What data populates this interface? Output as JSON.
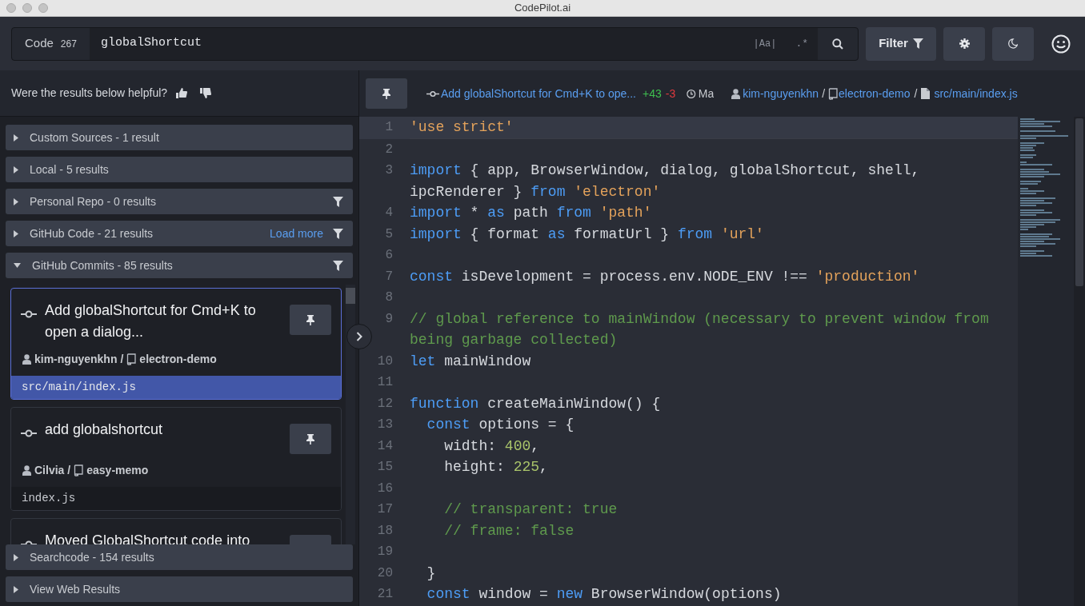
{
  "window": {
    "title": "CodePilot.ai"
  },
  "search": {
    "scope": "Code",
    "count": "267",
    "query": "globalShortcut",
    "case_toggle": "|Aa|",
    "regex_toggle": ".*"
  },
  "toolbar": {
    "filter_label": "Filter"
  },
  "feedback": {
    "question": "Were the results below helpful?"
  },
  "sections": [
    {
      "label": "Custom Sources - 1 result",
      "expanded": false,
      "filter": false
    },
    {
      "label": "Local - 5 results",
      "expanded": false,
      "filter": false
    },
    {
      "label": "Personal Repo - 0 results",
      "expanded": false,
      "filter": true
    },
    {
      "label": "GitHub Code - 21 results",
      "expanded": false,
      "filter": true,
      "action": "Load more"
    },
    {
      "label": "GitHub Commits - 85 results",
      "expanded": true,
      "filter": true,
      "results": [
        {
          "title": "Add globalShortcut for Cmd+K to open a dialog...",
          "author": "kim-nguyenkhn",
          "separator": "/",
          "repo": "electron-demo",
          "file": "src/main/index.js",
          "selected": true
        },
        {
          "title": "add globalshortcut",
          "author": "Cilvia",
          "separator": "/",
          "repo": "easy-memo",
          "file": "index.js",
          "selected": false
        },
        {
          "title": "Moved GlobalShortcut code into",
          "selected": false
        }
      ]
    },
    {
      "label": "Searchcode - 154 results",
      "expanded": false,
      "filter": false
    },
    {
      "label": "View Web Results",
      "expanded": false,
      "filter": false
    }
  ],
  "detail_bar": {
    "commit_title": "Add globalShortcut for Cmd+K to ope...",
    "additions": "+43",
    "deletions": "-3",
    "date": "Ma",
    "author": "kim-nguyenkhn",
    "separators": [
      "/",
      "/"
    ],
    "repo": "electron-demo",
    "path": "src/main/index.js"
  },
  "editor": {
    "lines": [
      {
        "n": "1",
        "current": true,
        "tokens": [
          {
            "kind": "string",
            "text": "'use strict'"
          }
        ]
      },
      {
        "n": "2",
        "current": false
      },
      {
        "n": "3",
        "current": false,
        "tokens": [
          {
            "kind": "keyword",
            "text": "import"
          },
          {
            "kind": "plain",
            "text": " { app, BrowserWindow, dialog, globalShortcut, shell, ipcRenderer } "
          },
          {
            "kind": "keyword",
            "text": "from "
          },
          {
            "kind": "string",
            "text": "'electron'"
          }
        ]
      },
      {
        "n": "4",
        "current": false,
        "tokens": [
          {
            "kind": "keyword",
            "text": "import"
          },
          {
            "kind": "plain",
            "text": " * "
          },
          {
            "kind": "keyword",
            "text": "as"
          },
          {
            "kind": "plain",
            "text": " path "
          },
          {
            "kind": "keyword",
            "text": "from "
          },
          {
            "kind": "string",
            "text": "'path'"
          }
        ]
      },
      {
        "n": "5",
        "current": false,
        "tokens": [
          {
            "kind": "keyword",
            "text": "import"
          },
          {
            "kind": "plain",
            "text": " { format "
          },
          {
            "kind": "keyword",
            "text": "as"
          },
          {
            "kind": "plain",
            "text": " formatUrl } "
          },
          {
            "kind": "keyword",
            "text": "from "
          },
          {
            "kind": "string",
            "text": "'url'"
          }
        ]
      },
      {
        "n": "6",
        "current": false
      },
      {
        "n": "7",
        "current": false,
        "tokens": [
          {
            "kind": "keyword",
            "text": "const"
          },
          {
            "kind": "plain",
            "text": " isDevelopment = process.env.NODE_ENV !== "
          },
          {
            "kind": "string",
            "text": "'production'"
          }
        ]
      },
      {
        "n": "8",
        "current": false
      },
      {
        "n": "9",
        "current": false,
        "tokens": [
          {
            "kind": "comment",
            "text": "// global reference to mainWindow (necessary to prevent window from being garbage collected)"
          }
        ]
      },
      {
        "n": "10",
        "current": false,
        "tokens": [
          {
            "kind": "keyword",
            "text": "let"
          },
          {
            "kind": "plain",
            "text": " mainWindow"
          }
        ]
      },
      {
        "n": "11",
        "current": false
      },
      {
        "n": "12",
        "current": false,
        "tokens": [
          {
            "kind": "keyword",
            "text": "function"
          },
          {
            "kind": "plain",
            "text": " createMainWindow() {"
          }
        ]
      },
      {
        "n": "13",
        "current": false,
        "tokens": [
          {
            "kind": "keyword",
            "text": "  const"
          },
          {
            "kind": "plain",
            "text": " options = {"
          }
        ]
      },
      {
        "n": "14",
        "current": false,
        "tokens": [
          {
            "kind": "plain",
            "text": "    width: "
          },
          {
            "kind": "number",
            "text": "400"
          },
          {
            "kind": "plain",
            "text": ","
          }
        ]
      },
      {
        "n": "15",
        "current": false,
        "tokens": [
          {
            "kind": "plain",
            "text": "    height: "
          },
          {
            "kind": "number",
            "text": "225"
          },
          {
            "kind": "plain",
            "text": ","
          }
        ]
      },
      {
        "n": "16",
        "current": false
      },
      {
        "n": "17",
        "current": false,
        "tokens": [
          {
            "kind": "comment",
            "text": "    // transparent: true"
          }
        ]
      },
      {
        "n": "18",
        "current": false,
        "tokens": [
          {
            "kind": "comment",
            "text": "    // frame: false"
          }
        ]
      },
      {
        "n": "19",
        "current": false
      },
      {
        "n": "20",
        "current": false,
        "tokens": [
          {
            "kind": "plain",
            "text": "  }"
          }
        ]
      },
      {
        "n": "21",
        "current": false,
        "tokens": [
          {
            "kind": "keyword",
            "text": "  const"
          },
          {
            "kind": "plain",
            "text": " window = "
          },
          {
            "kind": "keyword",
            "text": "new"
          },
          {
            "kind": "plain",
            "text": " BrowserWindow(options)"
          }
        ]
      }
    ]
  }
}
